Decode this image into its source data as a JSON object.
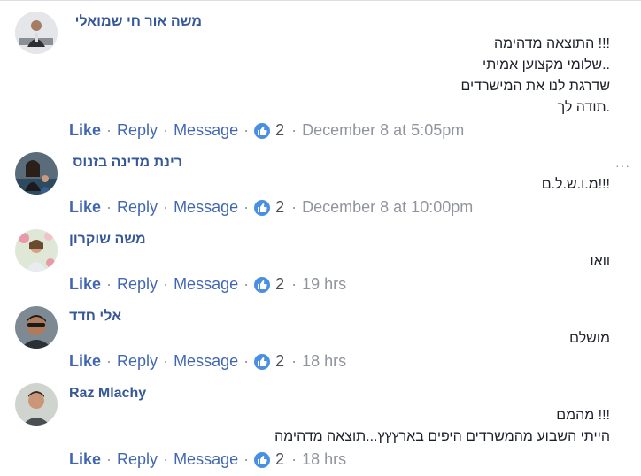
{
  "comments": [
    {
      "author": "משה אור חי שמואלי",
      "lines": [
        "!!! התוצאה מדהימה",
        "..שלומי מקצוען אמיתי",
        "שדרגת לנו את המישרדים",
        ".תודה לך"
      ],
      "like": "Like",
      "reply": "Reply",
      "message": "Message",
      "reactions": "2",
      "time": "December 8 at 5:05pm",
      "avatar_icon": "person-avatar-icon"
    },
    {
      "author": "רינת מדינה בזנוס",
      "lines": [
        "!!!מ.ו.ש.ל.ם"
      ],
      "like": "Like",
      "reply": "Reply",
      "message": "Message",
      "reactions": "2",
      "time": "December 8 at 10:00pm",
      "avatar_icon": "person-avatar-icon"
    },
    {
      "author": "משה שוקרון",
      "lines": [
        "וואו"
      ],
      "like": "Like",
      "reply": "Reply",
      "message": "Message",
      "reactions": "2",
      "time": "19 hrs",
      "avatar_icon": "person-avatar-icon"
    },
    {
      "author": "אלי חדד",
      "lines": [
        "מושלם"
      ],
      "like": "Like",
      "reply": "Reply",
      "message": "Message",
      "reactions": "2",
      "time": "18 hrs",
      "avatar_icon": "person-avatar-icon"
    },
    {
      "author": "Raz Mlachy",
      "lines": [
        "!!! מהמם",
        "הייתי השבוע מהמשרדים היפים בארץץץ...תוצאה מדהימה"
      ],
      "like": "Like",
      "reply": "Reply",
      "message": "Message",
      "reactions": "2",
      "time": "18 hrs",
      "avatar_icon": "person-avatar-icon"
    }
  ],
  "more_options": "···",
  "colors": {
    "link": "#4267b2",
    "author": "#365899",
    "meta": "#90949c",
    "like_badge": "#4a90e2"
  }
}
